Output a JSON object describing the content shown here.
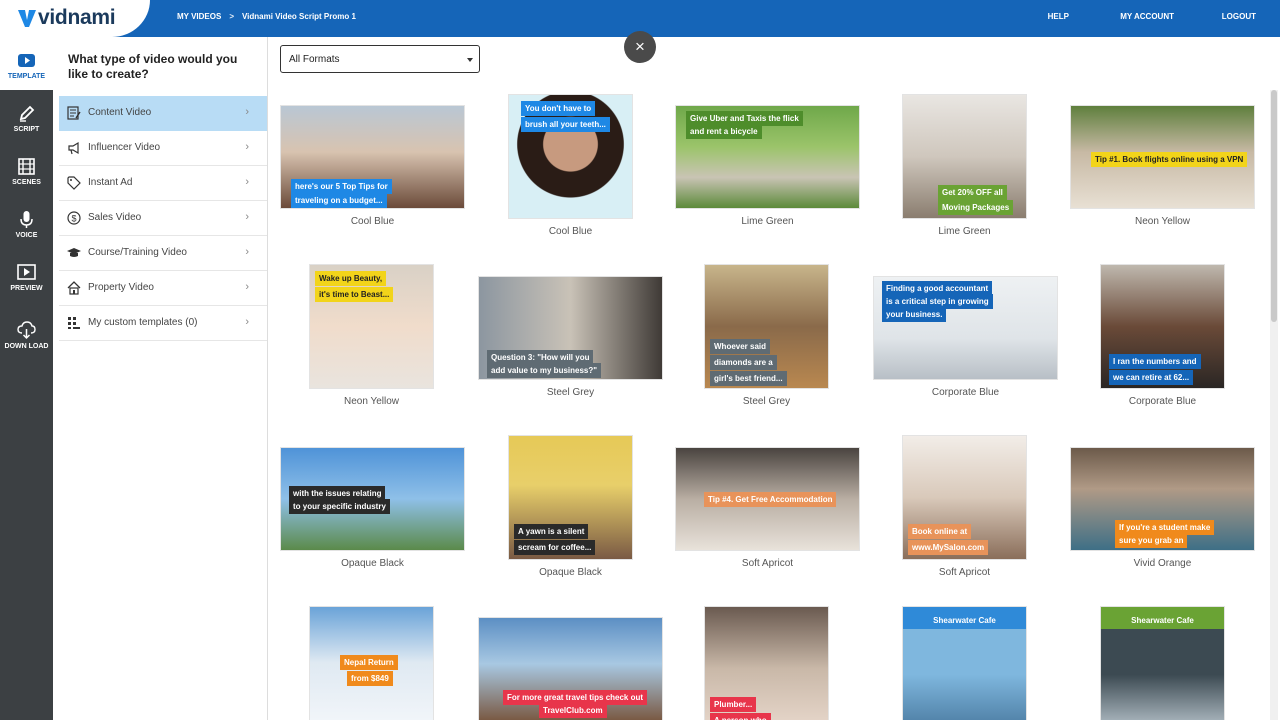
{
  "app": {
    "logo_text": "vidnami"
  },
  "breadcrumbs": [
    "MY VIDEOS",
    "Vidnami Video Script Promo 1"
  ],
  "topnav": [
    "HELP",
    "MY ACCOUNT",
    "LOGOUT"
  ],
  "rail": [
    {
      "label": "TEMPLATE",
      "icon": "play-icon",
      "active": true
    },
    {
      "label": "SCRIPT",
      "icon": "pencil-icon"
    },
    {
      "label": "SCENES",
      "icon": "film-icon"
    },
    {
      "label": "VOICE",
      "icon": "microphone-icon"
    },
    {
      "label": "PREVIEW",
      "icon": "preview-icon"
    },
    {
      "label": "DOWN LOAD",
      "icon": "download-icon"
    }
  ],
  "categories": {
    "title": "What type of video would you like to create?",
    "items": [
      {
        "label": "Content Video",
        "icon": "document-icon",
        "active": true
      },
      {
        "label": "Influencer Video",
        "icon": "megaphone-icon"
      },
      {
        "label": "Instant Ad",
        "icon": "tag-icon"
      },
      {
        "label": "Sales Video",
        "icon": "dollar-icon"
      },
      {
        "label": "Course/Training Video",
        "icon": "graduation-cap-icon"
      },
      {
        "label": "Property Video",
        "icon": "house-icon"
      },
      {
        "label": "My custom templates (0)",
        "icon": "grid-icon"
      }
    ]
  },
  "format_select": {
    "value": "All Formats"
  },
  "close_label": "×",
  "templates": [
    {
      "name": "Cool Blue",
      "captions": [
        "here's our 5 Top Tips for",
        "traveling on a budget..."
      ]
    },
    {
      "name": "Cool Blue",
      "captions": [
        "You don't have to",
        "brush all your teeth..."
      ]
    },
    {
      "name": "Lime Green",
      "captions": [
        "Give Uber and Taxis the flick",
        "and rent a bicycle"
      ]
    },
    {
      "name": "Lime Green",
      "captions": [
        "Get 20% OFF all",
        "Moving Packages"
      ]
    },
    {
      "name": "Neon Yellow",
      "captions": [
        "Tip #1. Book flights online using a VPN"
      ]
    },
    {
      "name": "Neon Yellow",
      "captions": [
        "Wake up Beauty,",
        "it's time to Beast..."
      ]
    },
    {
      "name": "Steel Grey",
      "captions": [
        "Question 3: \"How will you",
        "add value to my business?\""
      ]
    },
    {
      "name": "Steel Grey",
      "captions": [
        "Whoever said",
        "diamonds are a",
        "girl's best friend..."
      ]
    },
    {
      "name": "Corporate Blue",
      "captions": [
        "Finding a good accountant",
        "is a critical step in growing",
        "your business."
      ]
    },
    {
      "name": "Corporate Blue",
      "captions": [
        "I ran the numbers and",
        "we can retire at 62..."
      ]
    },
    {
      "name": "Opaque Black",
      "captions": [
        "with the issues relating",
        "to your specific industry"
      ]
    },
    {
      "name": "Opaque Black",
      "captions": [
        "A yawn is a silent",
        "scream for coffee..."
      ]
    },
    {
      "name": "Soft Apricot",
      "captions": [
        "Tip #4. Get Free Accommodation"
      ]
    },
    {
      "name": "Soft Apricot",
      "captions": [
        "Book online at",
        "www.MySalon.com"
      ]
    },
    {
      "name": "Vivid Orange",
      "captions": [
        "If you're a student make",
        "sure you grab an"
      ]
    },
    {
      "name": "",
      "captions": [
        "Nepal Return",
        "from $849"
      ]
    },
    {
      "name": "",
      "captions": [
        "For more great travel tips check out",
        "TravelClub.com"
      ]
    },
    {
      "name": "",
      "captions": [
        "Plumber...",
        "A person who"
      ]
    },
    {
      "name": "",
      "captions": [
        "Shearwater Cafe"
      ]
    },
    {
      "name": "",
      "captions": [
        "Shearwater Cafe"
      ]
    }
  ]
}
